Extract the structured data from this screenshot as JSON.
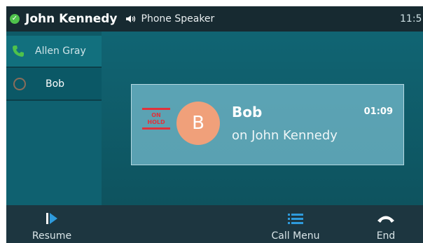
{
  "status_bar": {
    "account_name": "John Kennedy",
    "audio_device": "Phone Speaker",
    "clock": "11:5"
  },
  "lines": [
    {
      "label": "Allen Gray",
      "icon": "phone-icon"
    },
    {
      "label": "Bob",
      "icon": "hold-indicator-icon"
    }
  ],
  "call": {
    "status_badge": [
      "ON",
      "HOLD"
    ],
    "avatar_initial": "B",
    "caller_name": "Bob",
    "line_text": "on John Kennedy",
    "duration": "01:09"
  },
  "softkeys": {
    "resume": "Resume",
    "call_menu": "Call Menu",
    "end": "End"
  },
  "colors": {
    "accent_blue": "#2e9bdc",
    "hold_red": "#e0323b",
    "online_green": "#4fc24b",
    "avatar_peach": "#f0a07a"
  }
}
